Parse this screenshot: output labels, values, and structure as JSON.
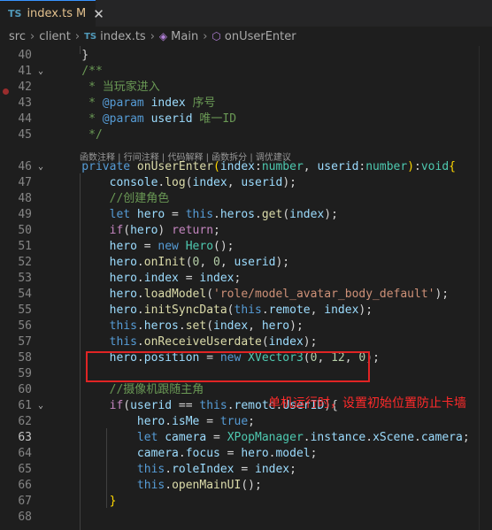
{
  "tab": {
    "icon": "TS",
    "filename": "index.ts",
    "modified": "M",
    "close": "✕"
  },
  "breadcrumb": {
    "src": "src",
    "client": "client",
    "file_icon": "TS",
    "file": "index.ts",
    "class": "Main",
    "method": "onUserEnter"
  },
  "codelens": "函数注释 | 行间注释 | 代码解释 | 函数拆分 | 调优建议",
  "lines": [
    {
      "n": "40",
      "tokens": [
        [
          "p",
          "    }"
        ]
      ]
    },
    {
      "n": "41",
      "tokens": [
        [
          "c",
          "    /**"
        ]
      ]
    },
    {
      "n": "42",
      "tokens": [
        [
          "c",
          "     * 当玩家进入"
        ]
      ]
    },
    {
      "n": "43",
      "tokens": [
        [
          "c",
          "     * "
        ],
        [
          "k",
          "@param"
        ],
        [
          "c",
          " "
        ],
        [
          "v",
          "index"
        ],
        [
          "c",
          " 序号"
        ]
      ]
    },
    {
      "n": "44",
      "tokens": [
        [
          "c",
          "     * "
        ],
        [
          "k",
          "@param"
        ],
        [
          "c",
          " "
        ],
        [
          "v",
          "userid"
        ],
        [
          "c",
          " 唯一ID"
        ]
      ]
    },
    {
      "n": "45",
      "tokens": [
        [
          "c",
          "     */"
        ]
      ]
    },
    {
      "n": "46",
      "tokens": [
        [
          "k",
          "    private "
        ],
        [
          "f",
          "onUserEnter"
        ],
        [
          "y",
          "("
        ],
        [
          "v",
          "index"
        ],
        [
          "p",
          ":"
        ],
        [
          "t",
          "number"
        ],
        [
          "p",
          ", "
        ],
        [
          "v",
          "userid"
        ],
        [
          "p",
          ":"
        ],
        [
          "t",
          "number"
        ],
        [
          "y",
          ")"
        ],
        [
          "p",
          ":"
        ],
        [
          "t",
          "void"
        ],
        [
          "y",
          "{"
        ]
      ]
    },
    {
      "n": "47",
      "tokens": [
        [
          "v",
          "        console"
        ],
        [
          "p",
          "."
        ],
        [
          "f",
          "log"
        ],
        [
          "p",
          "("
        ],
        [
          "v",
          "index"
        ],
        [
          "p",
          ", "
        ],
        [
          "v",
          "userid"
        ],
        [
          "p",
          ");"
        ]
      ]
    },
    {
      "n": "48",
      "tokens": [
        [
          "c",
          "        //创建角色"
        ]
      ]
    },
    {
      "n": "49",
      "tokens": [
        [
          "k",
          "        let "
        ],
        [
          "v",
          "hero"
        ],
        [
          "p",
          " = "
        ],
        [
          "k",
          "this"
        ],
        [
          "p",
          "."
        ],
        [
          "v",
          "heros"
        ],
        [
          "p",
          "."
        ],
        [
          "f",
          "get"
        ],
        [
          "p",
          "("
        ],
        [
          "v",
          "index"
        ],
        [
          "p",
          ");"
        ]
      ]
    },
    {
      "n": "50",
      "tokens": [
        [
          "kc",
          "        if"
        ],
        [
          "p",
          "("
        ],
        [
          "v",
          "hero"
        ],
        [
          "p",
          ") "
        ],
        [
          "kc",
          "return"
        ],
        [
          "p",
          ";"
        ]
      ]
    },
    {
      "n": "51",
      "tokens": [
        [
          "v",
          "        hero"
        ],
        [
          "p",
          " = "
        ],
        [
          "k",
          "new "
        ],
        [
          "t",
          "Hero"
        ],
        [
          "p",
          "();"
        ]
      ]
    },
    {
      "n": "52",
      "tokens": [
        [
          "v",
          "        hero"
        ],
        [
          "p",
          "."
        ],
        [
          "f",
          "onInit"
        ],
        [
          "p",
          "("
        ],
        [
          "n",
          "0"
        ],
        [
          "p",
          ", "
        ],
        [
          "n",
          "0"
        ],
        [
          "p",
          ", "
        ],
        [
          "v",
          "userid"
        ],
        [
          "p",
          ");"
        ]
      ]
    },
    {
      "n": "53",
      "tokens": [
        [
          "v",
          "        hero"
        ],
        [
          "p",
          "."
        ],
        [
          "v",
          "index"
        ],
        [
          "p",
          " = "
        ],
        [
          "v",
          "index"
        ],
        [
          "p",
          ";"
        ]
      ]
    },
    {
      "n": "54",
      "tokens": [
        [
          "v",
          "        hero"
        ],
        [
          "p",
          "."
        ],
        [
          "f",
          "loadModel"
        ],
        [
          "p",
          "("
        ],
        [
          "s",
          "'role/model_avatar_body_default'"
        ],
        [
          "p",
          ");"
        ]
      ]
    },
    {
      "n": "55",
      "tokens": [
        [
          "v",
          "        hero"
        ],
        [
          "p",
          "."
        ],
        [
          "f",
          "initSyncData"
        ],
        [
          "p",
          "("
        ],
        [
          "k",
          "this"
        ],
        [
          "p",
          "."
        ],
        [
          "v",
          "remote"
        ],
        [
          "p",
          ", "
        ],
        [
          "v",
          "index"
        ],
        [
          "p",
          ");"
        ]
      ]
    },
    {
      "n": "56",
      "tokens": [
        [
          "k",
          "        this"
        ],
        [
          "p",
          "."
        ],
        [
          "v",
          "heros"
        ],
        [
          "p",
          "."
        ],
        [
          "f",
          "set"
        ],
        [
          "p",
          "("
        ],
        [
          "v",
          "index"
        ],
        [
          "p",
          ", "
        ],
        [
          "v",
          "hero"
        ],
        [
          "p",
          ");"
        ]
      ]
    },
    {
      "n": "57",
      "tokens": [
        [
          "k",
          "        this"
        ],
        [
          "p",
          "."
        ],
        [
          "f",
          "onReceiveUserdate"
        ],
        [
          "p",
          "("
        ],
        [
          "v",
          "index"
        ],
        [
          "p",
          ");"
        ]
      ]
    },
    {
      "n": "58",
      "tokens": [
        [
          "v",
          "        hero"
        ],
        [
          "p",
          "."
        ],
        [
          "v",
          "position"
        ],
        [
          "p",
          " = "
        ],
        [
          "k",
          "new "
        ],
        [
          "t",
          "XVector3"
        ],
        [
          "p",
          "("
        ],
        [
          "n",
          "0"
        ],
        [
          "p",
          ", "
        ],
        [
          "n",
          "12"
        ],
        [
          "p",
          ", "
        ],
        [
          "n",
          "0"
        ],
        [
          "p",
          ");"
        ]
      ]
    },
    {
      "n": "59",
      "tokens": []
    },
    {
      "n": "60",
      "tokens": [
        [
          "c",
          "        //摄像机跟随主角"
        ]
      ]
    },
    {
      "n": "61",
      "tokens": [
        [
          "kc",
          "        if"
        ],
        [
          "p",
          "("
        ],
        [
          "v",
          "userid"
        ],
        [
          "p",
          " == "
        ],
        [
          "k",
          "this"
        ],
        [
          "p",
          "."
        ],
        [
          "v",
          "remote"
        ],
        [
          "p",
          "."
        ],
        [
          "v",
          "UserID"
        ],
        [
          "p",
          "){"
        ]
      ]
    },
    {
      "n": "62",
      "tokens": [
        [
          "v",
          "            hero"
        ],
        [
          "p",
          "."
        ],
        [
          "v",
          "isMe"
        ],
        [
          "p",
          " = "
        ],
        [
          "k",
          "true"
        ],
        [
          "p",
          ";"
        ]
      ]
    },
    {
      "n": "63",
      "tokens": [
        [
          "k",
          "            let "
        ],
        [
          "v",
          "camera"
        ],
        [
          "p",
          " = "
        ],
        [
          "t",
          "XPopManager"
        ],
        [
          "p",
          "."
        ],
        [
          "v",
          "instance"
        ],
        [
          "p",
          "."
        ],
        [
          "v",
          "xScene"
        ],
        [
          "p",
          "."
        ],
        [
          "v",
          "camera"
        ],
        [
          "p",
          ";"
        ]
      ]
    },
    {
      "n": "64",
      "tokens": [
        [
          "v",
          "            camera"
        ],
        [
          "p",
          "."
        ],
        [
          "v",
          "focus"
        ],
        [
          "p",
          " = "
        ],
        [
          "v",
          "hero"
        ],
        [
          "p",
          "."
        ],
        [
          "v",
          "model"
        ],
        [
          "p",
          ";"
        ]
      ]
    },
    {
      "n": "65",
      "tokens": [
        [
          "k",
          "            this"
        ],
        [
          "p",
          "."
        ],
        [
          "v",
          "roleIndex"
        ],
        [
          "p",
          " = "
        ],
        [
          "v",
          "index"
        ],
        [
          "p",
          ";"
        ]
      ]
    },
    {
      "n": "66",
      "tokens": [
        [
          "k",
          "            this"
        ],
        [
          "p",
          "."
        ],
        [
          "f",
          "openMainUI"
        ],
        [
          "p",
          "();"
        ]
      ]
    },
    {
      "n": "67",
      "tokens": [
        [
          "y",
          "        }"
        ]
      ]
    },
    {
      "n": "68",
      "tokens": []
    }
  ],
  "annotation": "单机运行时，设置初始位置防止卡墙",
  "colors": {
    "keyword": "#569cd6",
    "control": "#c586c0",
    "variable": "#9cdcfe",
    "function": "#dcdcaa",
    "type": "#4ec9b0",
    "string": "#ce9178",
    "number": "#b5cea8",
    "comment": "#6a9955",
    "annotation": "#ff2a2a",
    "breakpoint": "#9a2d2d"
  }
}
